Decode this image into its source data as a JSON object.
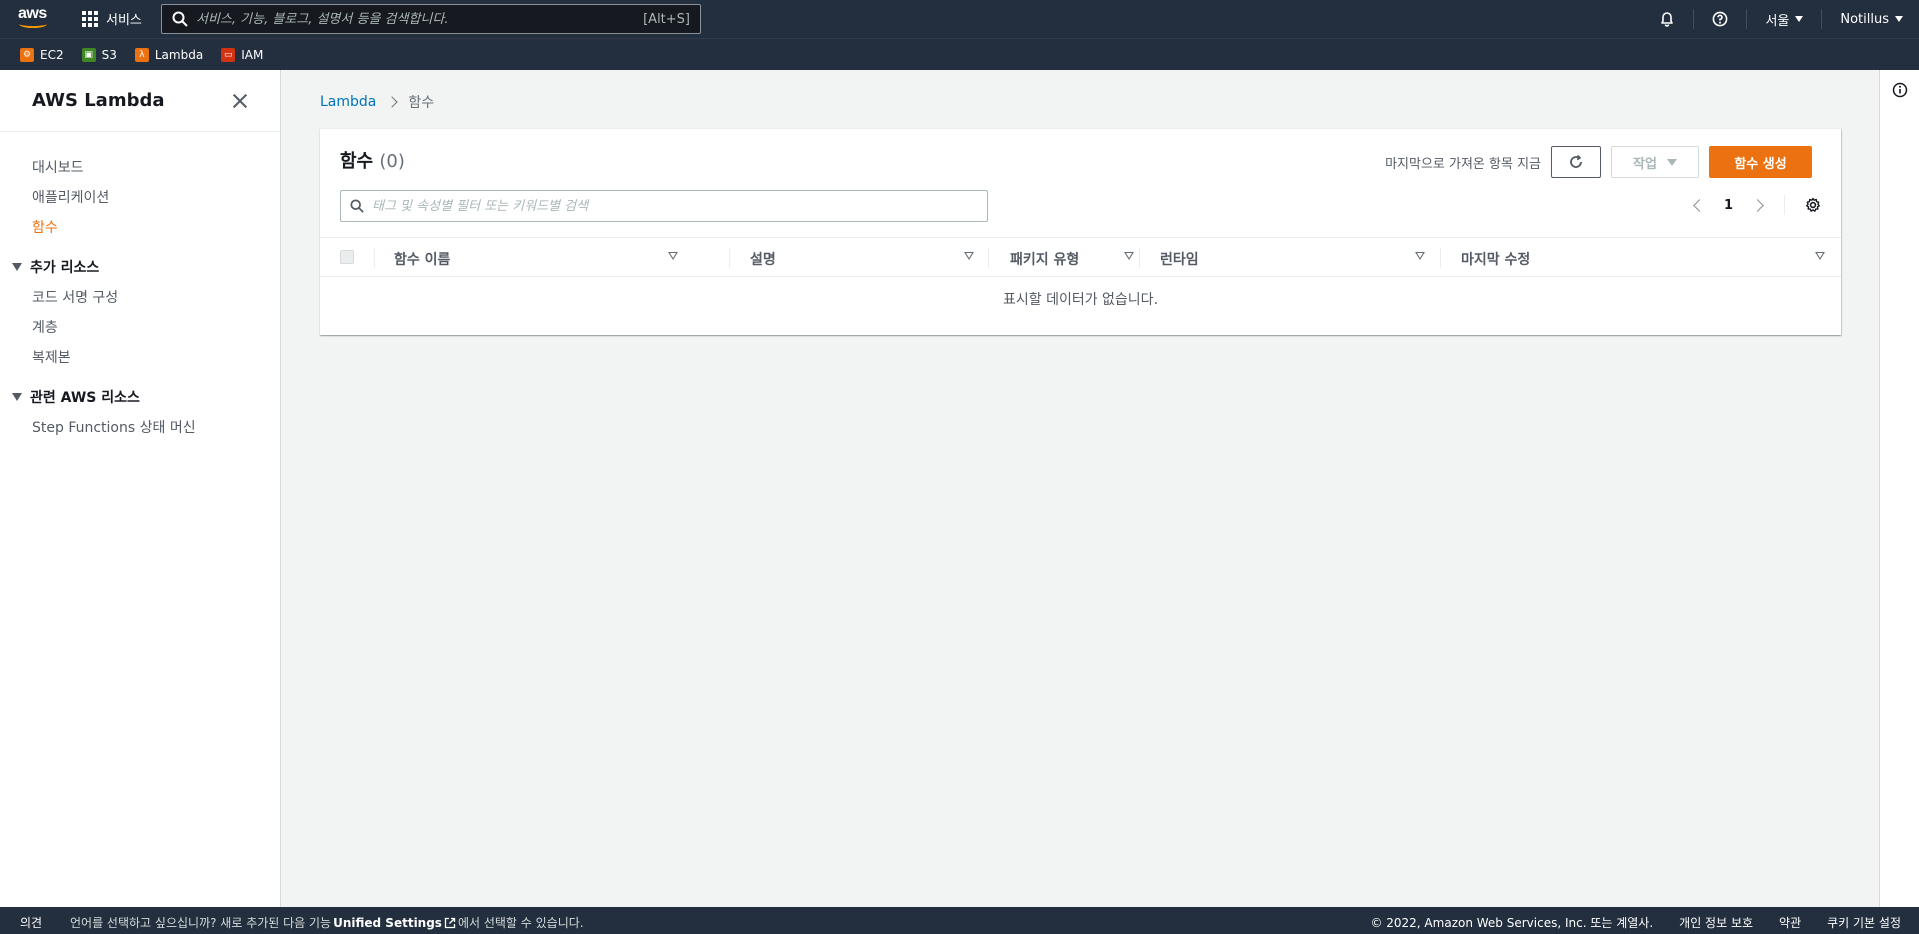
{
  "topnav": {
    "logo_text": "aws",
    "services_label": "서비스",
    "search_placeholder": "서비스, 기능, 블로그, 설명서 등을 검색합니다.",
    "search_shortcut": "[Alt+S]",
    "region_label": "서울",
    "account_label": "Notillus"
  },
  "favorites": [
    {
      "label": "EC2",
      "color": "#ec7211"
    },
    {
      "label": "S3",
      "color": "#3f8624"
    },
    {
      "label": "Lambda",
      "color": "#ec7211"
    },
    {
      "label": "IAM",
      "color": "#d13212"
    }
  ],
  "sidebar": {
    "title": "AWS Lambda",
    "items": [
      {
        "label": "대시보드"
      },
      {
        "label": "애플리케이션"
      },
      {
        "label": "함수",
        "active": true
      }
    ],
    "sections": [
      {
        "title": "추가 리소스",
        "items": [
          {
            "label": "코드 서명 구성"
          },
          {
            "label": "계층"
          },
          {
            "label": "복제본"
          }
        ]
      },
      {
        "title": "관련 AWS 리소스",
        "items": [
          {
            "label": "Step Functions 상태 머신"
          }
        ]
      }
    ]
  },
  "breadcrumb": {
    "root": "Lambda",
    "current": "함수"
  },
  "panel": {
    "title": "함수",
    "count": "(0)",
    "last_fetched": "마지막으로 가져온 항목 지금",
    "actions_label": "작업",
    "create_label": "함수 생성",
    "filter_placeholder": "태그 및 속성별 필터 또는 키워드별 검색",
    "page_number": "1",
    "columns": [
      "함수 이름",
      "설명",
      "패키지 유형",
      "런타임",
      "마지막 수정"
    ],
    "empty_text": "표시할 데이터가 없습니다."
  },
  "footer": {
    "feedback": "의견",
    "lang_prefix": "언어를 선택하고 싶으십니까? 새로 추가된 다음 기능",
    "lang_link": "Unified Settings",
    "lang_suffix": "에서 선택할 수 있습니다.",
    "copyright": "© 2022, Amazon Web Services, Inc. 또는 계열사.",
    "privacy": "개인 정보 보호",
    "terms": "약관",
    "cookies": "쿠키 기본 설정"
  },
  "colors": {
    "accent": "#ec7211",
    "link": "#0073bb",
    "nav_bg": "#232f3e"
  }
}
